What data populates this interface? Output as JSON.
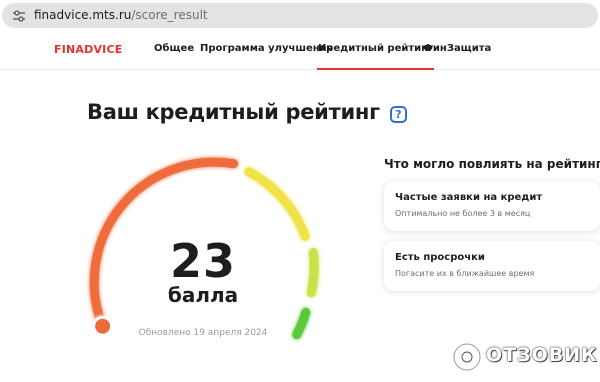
{
  "browser": {
    "url_host": "finadvice.mts.ru",
    "url_path": "/score_result"
  },
  "header": {
    "logo": "FINADVICE",
    "nav": [
      {
        "label": "Общее",
        "active": false
      },
      {
        "label": "Программа улучшения",
        "active": false
      },
      {
        "label": "Кредитный рейтинг",
        "active": true
      },
      {
        "label": "ФинЗащита",
        "active": false
      }
    ]
  },
  "main": {
    "title": "Ваш кредитный рейтинг",
    "help_icon": "question-icon",
    "help_glyph": "?",
    "score": {
      "value": "23",
      "unit": "балла",
      "updated": "Обновлено 19 апреля 2024",
      "level_fraction": 0.0
    },
    "factors": {
      "title": "Что могло повлиять на рейтинг",
      "items": [
        {
          "title": "Частые заявки на кредит",
          "subtitle": "Оптимально не более 3 в месяц"
        },
        {
          "title": "Есть просрочки",
          "subtitle": "Погасите их в ближайшее время"
        }
      ]
    }
  },
  "watermark": {
    "text": "ОТЗОВИК"
  },
  "colors": {
    "brand": "#e5322d",
    "accent_blue": "#2f6fd6",
    "gauge_red": "#ef6a3a",
    "gauge_yellow": "#f0e24a",
    "gauge_lime": "#c8e34a",
    "gauge_green": "#5cc93b"
  }
}
